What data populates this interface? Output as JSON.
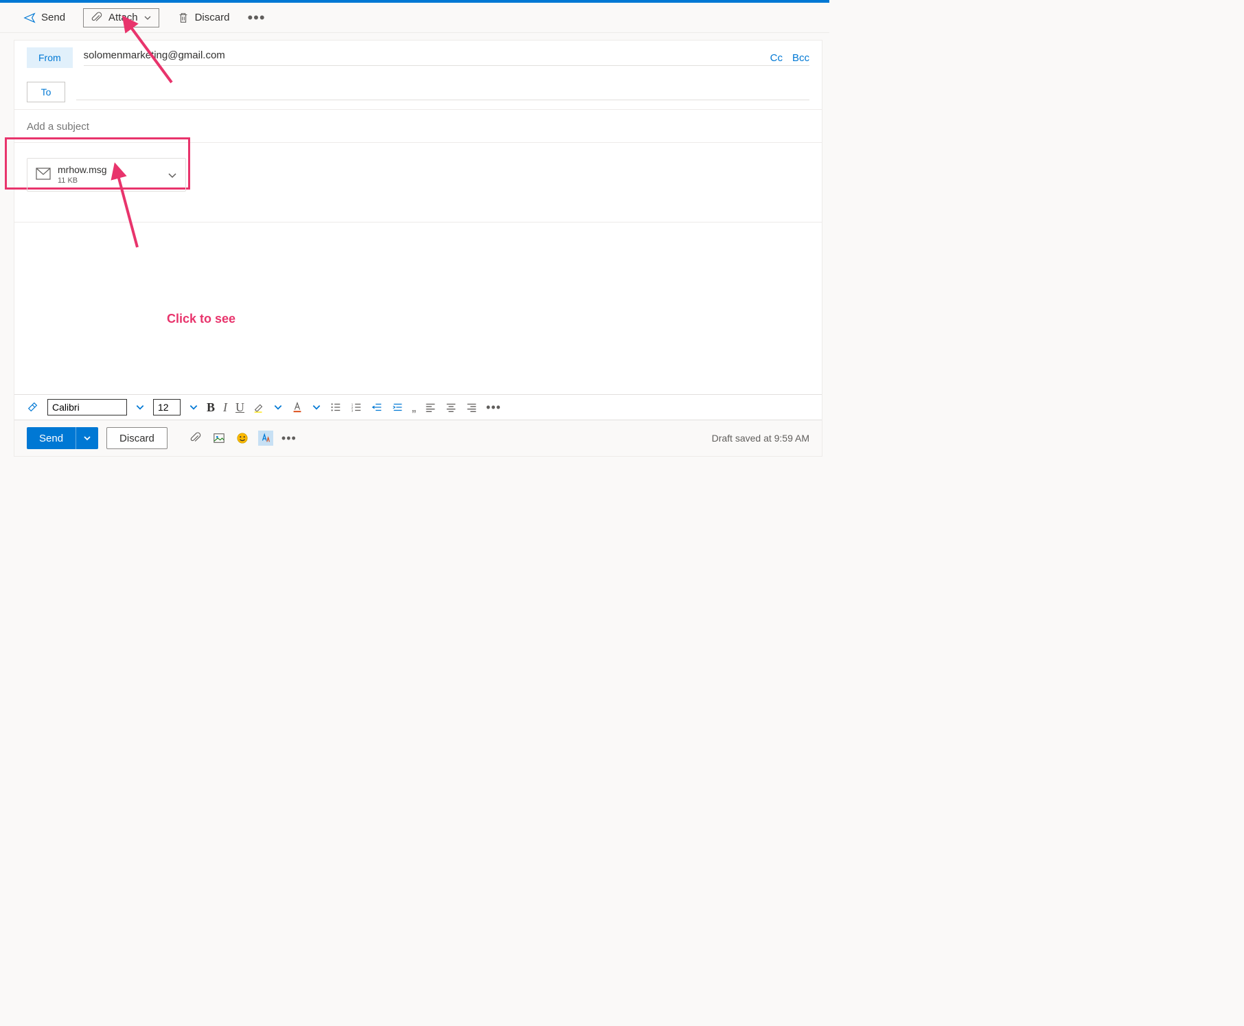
{
  "toolbar": {
    "send": "Send",
    "attach": "Attach",
    "discard": "Discard"
  },
  "fields": {
    "from_label": "From",
    "from_value": "solomenmarketing@gmail.com",
    "to_label": "To",
    "cc": "Cc",
    "bcc": "Bcc",
    "subject_placeholder": "Add a subject"
  },
  "attachment": {
    "name": "mrhow.msg",
    "size": "11 KB"
  },
  "annotation": {
    "text": "Click to see"
  },
  "format": {
    "font": "Calibri",
    "size": "12",
    "bold": "B",
    "italic": "I",
    "underline": "U",
    "quote": "„"
  },
  "bottom": {
    "send": "Send",
    "discard": "Discard",
    "draft_status": "Draft saved at 9:59 AM"
  }
}
